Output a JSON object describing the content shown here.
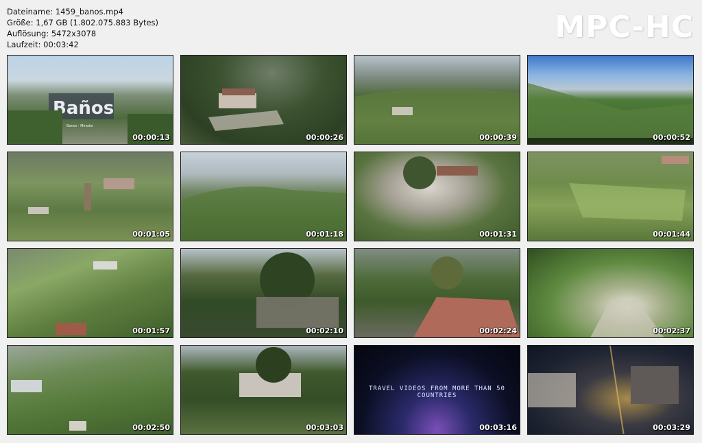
{
  "file_info": {
    "filename_line": "Dateiname: 1459_banos.mp4",
    "size_line": "Größe: 1,67 GB (1.802.075.883 Bytes)",
    "resolution_line": "Auflösung: 5472x3078",
    "duration_line": "Laufzeit: 00:03:42"
  },
  "logo": "MPC-HC",
  "thumbnails": [
    {
      "time": "00:00:13",
      "sign_text": "Banos · Mirador"
    },
    {
      "time": "00:00:26"
    },
    {
      "time": "00:00:39"
    },
    {
      "time": "00:00:52"
    },
    {
      "time": "00:01:05"
    },
    {
      "time": "00:01:18"
    },
    {
      "time": "00:01:31"
    },
    {
      "time": "00:01:44"
    },
    {
      "time": "00:01:57"
    },
    {
      "time": "00:02:10"
    },
    {
      "time": "00:02:24"
    },
    {
      "time": "00:02:37"
    },
    {
      "time": "00:02:50"
    },
    {
      "time": "00:03:03"
    },
    {
      "time": "00:03:16",
      "overlay": "TRAVEL VIDEOS FROM MORE THAN 50 COUNTRIES"
    },
    {
      "time": "00:03:29"
    }
  ]
}
